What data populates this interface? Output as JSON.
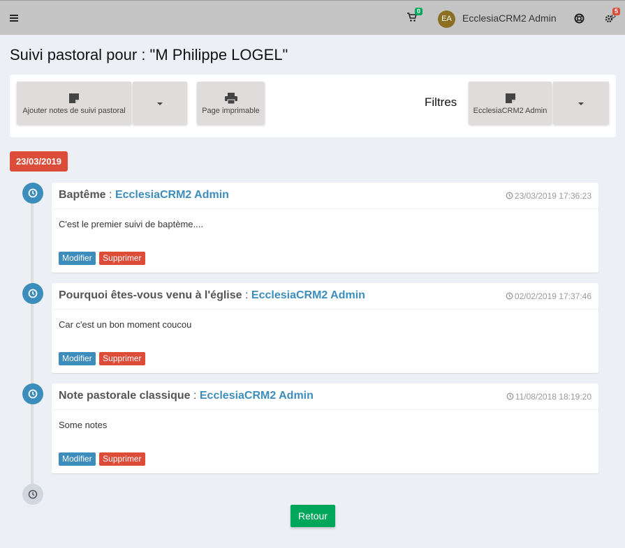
{
  "header": {
    "cart_count": "0",
    "avatar_initials": "EA",
    "username": "EcclesiaCRM2 Admin",
    "settings_badge": "5",
    "icons": [
      "menu-icon",
      "cart-icon",
      "lifebuoy-icon",
      "gears-icon"
    ]
  },
  "page": {
    "title": "Suivi pastoral pour : \"M Philippe LOGEL\""
  },
  "toolbar": {
    "add_notes_label": "Ajouter notes de suivi pastoral",
    "print_label": "Page imprimable",
    "filters_label": "Filtres",
    "filter_user_label": "EcclesiaCRM2 Admin"
  },
  "timeline": {
    "date_label": "23/03/2019",
    "separator": ":",
    "items": [
      {
        "type": "Baptême",
        "author": "EcclesiaCRM2 Admin",
        "timestamp": "23/03/2019 17:36:23",
        "body": "C'est le premier suivi de baptème....",
        "edit_label": "Modifier",
        "delete_label": "Supprimer"
      },
      {
        "type": "Pourquoi êtes-vous venu à l'église",
        "author": "EcclesiaCRM2 Admin",
        "timestamp": "02/02/2019 17:37:46",
        "body": "Car c'est un bon moment coucou",
        "edit_label": "Modifier",
        "delete_label": "Supprimer"
      },
      {
        "type": "Note pastorale classique",
        "author": "EcclesiaCRM2 Admin",
        "timestamp": "11/08/2018 18:19:20",
        "body": "Some notes",
        "edit_label": "Modifier",
        "delete_label": "Supprimer"
      }
    ]
  },
  "footer": {
    "back_label": "Retour"
  },
  "colors": {
    "primary": "#3c8dbc",
    "danger": "#dd4b39",
    "success": "#00a65a",
    "topbar": "#c4c4c4",
    "background": "#ecf0f5"
  }
}
